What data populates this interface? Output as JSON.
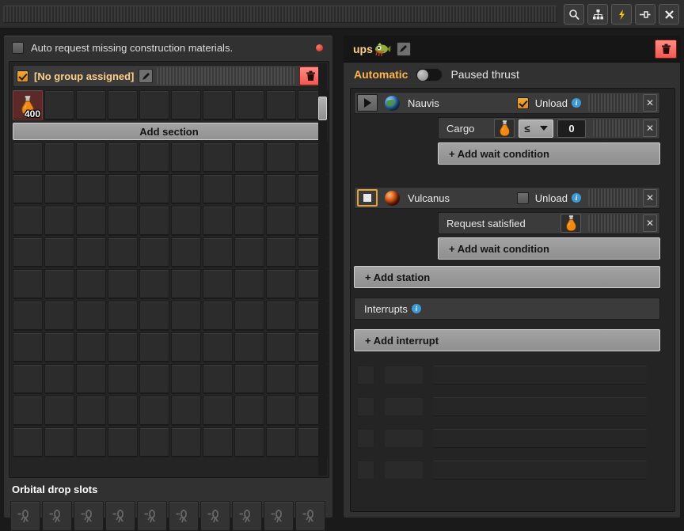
{
  "titlebar": {
    "buttons": [
      {
        "name": "search-icon",
        "label": "Search"
      },
      {
        "name": "network-icon",
        "label": "Network"
      },
      {
        "name": "power-icon",
        "label": "Power"
      },
      {
        "name": "pin-icon",
        "label": "Pin"
      },
      {
        "name": "close-icon",
        "label": "Close"
      }
    ]
  },
  "left_panel": {
    "auto_request": {
      "label": "Auto request missing construction materials.",
      "checked": false
    },
    "group": {
      "title": "[No group assigned]",
      "checked": true,
      "edit_label": "Edit",
      "delete_label": "Delete"
    },
    "add_section_label": "Add section",
    "filled_slot": {
      "count": "400",
      "item": "science-pack-flask"
    },
    "slot_columns": 10,
    "orbital": {
      "title": "Orbital drop slots",
      "slot_count": 10,
      "placeholder_icon": "cargo-pod-icon"
    }
  },
  "right_panel": {
    "title": "ups",
    "title_sprite": "fish-sprite-icon",
    "edit_label": "Edit",
    "delete_label": "Delete",
    "mode": {
      "automatic_label": "Automatic",
      "toggle_on": false,
      "paused_label": "Paused thrust"
    },
    "stations": [
      {
        "name": "Nauvis",
        "planet_icon": "planet-nauvis-icon",
        "control": "play",
        "unload_label": "Unload",
        "unload_checked": true,
        "conditions": [
          {
            "kind": "cargo",
            "label": "Cargo",
            "item_icon": "science-pack-flask",
            "operator": "≤",
            "value": "0"
          }
        ],
        "add_condition_label": "+ Add wait condition"
      },
      {
        "name": "Vulcanus",
        "planet_icon": "planet-vulcanus-icon",
        "control": "stop",
        "unload_label": "Unload",
        "unload_checked": false,
        "conditions": [
          {
            "kind": "request-satisfied",
            "label": "Request satisfied",
            "item_icon": "science-pack-flask",
            "operator": "",
            "value": ""
          }
        ],
        "add_condition_label": "+ Add wait condition"
      }
    ],
    "add_station_label": "+ Add station",
    "interrupts_label": "Interrupts",
    "add_interrupt_label": "+ Add interrupt"
  },
  "colors": {
    "accent_orange": "#ffcf8a",
    "active_orange": "#ffb648",
    "danger_red": "#f05850",
    "info_blue": "#3d9ad6",
    "button_gray": "#9a9a9a"
  }
}
